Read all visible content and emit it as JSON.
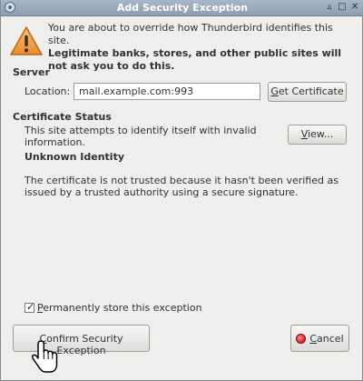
{
  "window": {
    "title": "Add Security Exception",
    "controls": {
      "shade": "▵",
      "maximize": "□",
      "close": "✕"
    }
  },
  "intro": {
    "text": "You are about to override how Thunderbird identifies this site.",
    "warning": "Legitimate banks, stores, and other public sites will not ask you to do this."
  },
  "server": {
    "section_title": "Server",
    "location_label": "Location:",
    "location_value": "mail.example.com:993",
    "get_certificate_prefix": "G",
    "get_certificate_rest": "et Certificate"
  },
  "certificate_status": {
    "section_title": "Certificate Status",
    "status_text": "This site attempts to identify itself with invalid information.",
    "view_prefix": "V",
    "view_rest": "iew...",
    "identity_heading": "Unknown Identity",
    "explanation": "The certificate is not trusted because it hasn't been verified as issued by a trusted authority using a secure signature."
  },
  "options": {
    "permanent_checked": true,
    "permanent_prefix": "P",
    "permanent_rest": "ermanently store this exception"
  },
  "buttons": {
    "confirm_prefix": "C",
    "confirm_rest": "onfirm Security Exception",
    "cancel_prefix": "C",
    "cancel_rest": "ancel"
  },
  "icons": {
    "app": "thunderbird-icon",
    "warning": "warning-triangle-icon",
    "cancel": "cancel-icon",
    "cursor": "hand-pointer-icon",
    "accent_colors": {
      "title_bar": "#97a6b8",
      "warning": "#f0a24a",
      "cancel": "#c40000"
    }
  }
}
